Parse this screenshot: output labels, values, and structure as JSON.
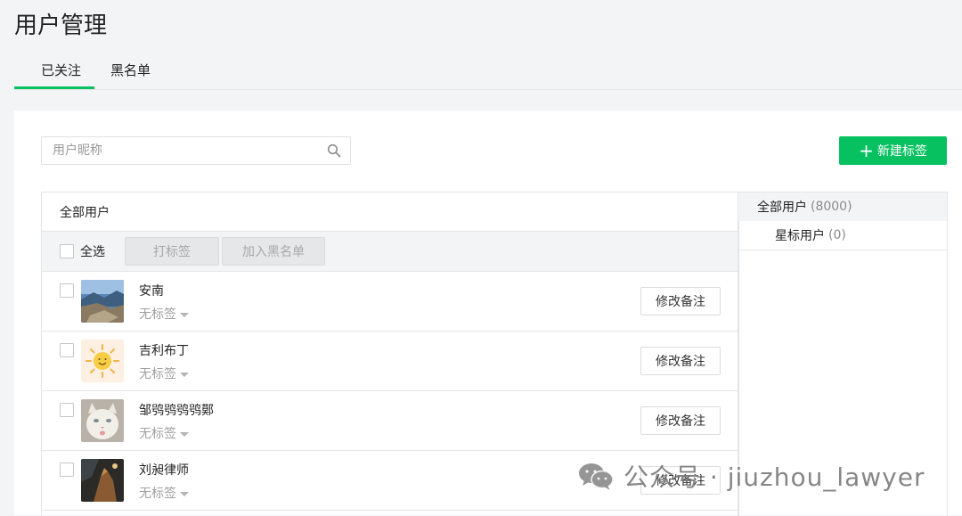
{
  "page": {
    "title": "用户管理"
  },
  "tabs": [
    {
      "label": "已关注"
    },
    {
      "label": "黑名单"
    }
  ],
  "search": {
    "placeholder": "用户昵称",
    "value": ""
  },
  "new_tag_button": {
    "icon": "plus-icon",
    "label": "新建标签"
  },
  "list": {
    "heading": "全部用户",
    "select_all_label": "全选",
    "actions": [
      {
        "label": "打标签"
      },
      {
        "label": "加入黑名单"
      }
    ],
    "users": [
      {
        "name": "安南",
        "tag": "无标签",
        "remark_label": "修改备注"
      },
      {
        "name": "吉利布丁",
        "tag": "无标签",
        "remark_label": "修改备注"
      },
      {
        "name": "邹鸮鸮鸮鸮鄚",
        "tag": "无标签",
        "remark_label": "修改备注"
      },
      {
        "name": "刘昶律师",
        "tag": "无标签",
        "remark_label": "修改备注"
      }
    ]
  },
  "sidebar": {
    "groups": [
      {
        "name": "全部用户",
        "count": "(8000)"
      },
      {
        "name": "星标用户",
        "count": "(0)"
      }
    ]
  },
  "watermark": {
    "text": "公众号 · jiuzhou_lawyer"
  },
  "colors": {
    "accent": "#07c160",
    "background": "#f3f4f6"
  }
}
